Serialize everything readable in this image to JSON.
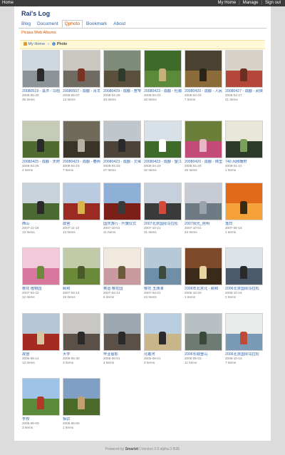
{
  "topbar": {
    "home": "Home",
    "my_home": "My Home",
    "manage": "Manage",
    "sign_out": "Sign out",
    "sep": "|"
  },
  "site_title": "Rai's Log",
  "nav": [
    {
      "label": "Blog",
      "active": false
    },
    {
      "label": "Document",
      "active": false
    },
    {
      "label": "Qphoto",
      "active": true
    },
    {
      "label": "Bookmark",
      "active": false
    },
    {
      "label": "About",
      "active": false
    }
  ],
  "section_title": "Picasa Web Albums",
  "breadcrumb": {
    "my_home": "My Home",
    "current": "Photo",
    "sep": "»"
  },
  "albums": [
    {
      "title": "20080519 - 溪洪 - 马柏镇",
      "date": "2008-05-20",
      "count": "35 Items"
    },
    {
      "title": "20080507 - 成都 - 青羊宫殿",
      "date": "2008-05-07",
      "count": "13 Items"
    },
    {
      "title": "20080429 - 成都 - 宽窄巷",
      "date": "2008-04-29",
      "count": "33 Items"
    },
    {
      "title": "20080423 - 成都 - 杜甫草堂",
      "date": "2008-04-23",
      "count": "32 Items"
    },
    {
      "title": "20080420 - 成都 - 人民公园",
      "date": "2008-04-20",
      "count": "7 Items"
    },
    {
      "title": "20080427 - 成都 - 武侯祠",
      "date": "2008-04-27",
      "count": "21 Items"
    },
    {
      "title": "20080425 - 成都 - 天府广场",
      "date": "2008-04-25",
      "count": "4 Items"
    },
    {
      "title": "20080423 - 成都 - 春熙路",
      "date": "2008-04-23",
      "count": "7 Items"
    },
    {
      "title": "20080423 - 成都 - 文殊院",
      "date": "2008-04-23",
      "count": "27 Items"
    },
    {
      "title": "20080423 - 成都 - 望江楼",
      "date": "2008-04-23",
      "count": "32 Items"
    },
    {
      "title": "20080420 - 成都 - 锦里",
      "date": "2008-04-20",
      "count": "26 Items"
    },
    {
      "title": "740 风和暖时",
      "date": "2008-01-10",
      "count": "1 Items"
    },
    {
      "title": "西山",
      "date": "2007-11-18",
      "count": "13 Items"
    },
    {
      "title": "故宫",
      "date": "2007-11-10",
      "count": "13 Items"
    },
    {
      "title": "国庆游行 - 升旗仪式",
      "date": "2007-10-01",
      "count": "11 Items"
    },
    {
      "title": "2007北京国际马拉松",
      "date": "2007-10-21",
      "count": "31 Items"
    },
    {
      "title": "2007阳光_昆明",
      "date": "2007-10-01",
      "count": "44 Items"
    },
    {
      "title": "落日",
      "date": "2007-05-18",
      "count": "1 Items"
    },
    {
      "title": "樱花 植物园",
      "date": "2007-04-22",
      "count": "12 Items"
    },
    {
      "title": "颐和",
      "date": "2007-04-14",
      "count": "19 Items"
    },
    {
      "title": "奥运 樱花园",
      "date": "2007-04-14",
      "count": "6 Items"
    },
    {
      "title": "樱花 玉渊潭",
      "date": "2007-04-01",
      "count": "22 Items"
    },
    {
      "title": "2006年北京北 - 颐和",
      "date": "2006-10-20",
      "count": "1 Items"
    },
    {
      "title": "2006北京国际马拉松",
      "date": "2006-10-15",
      "count": "2 Items"
    },
    {
      "title": "故宫",
      "date": "2006-08-14",
      "count": "13 Items"
    },
    {
      "title": "大学",
      "date": "2006-06-30",
      "count": "3 Items"
    },
    {
      "title": "毕业留影",
      "date": "2006-06-01",
      "count": "4 Items"
    },
    {
      "title": "北戴河",
      "date": "2006-06-01",
      "count": "3 Items"
    },
    {
      "title": "2006长城登山",
      "date": "2006-05-03",
      "count": "11 Items"
    },
    {
      "title": "2006北京国际马拉松",
      "date": "2006-10-15",
      "count": "7 Items"
    },
    {
      "title": "学校",
      "date": "2006-06-00",
      "count": "3 Items"
    },
    {
      "title": "相识",
      "date": "2006-06-00",
      "count": "1 Items"
    }
  ],
  "thumb_palettes": [
    [
      "#cfd8de",
      "#8b9397",
      "#2a2a2a"
    ],
    [
      "#c9c7c0",
      "#6f6b63",
      "#7a3322"
    ],
    [
      "#7f8b7a",
      "#5a4f3a",
      "#2e3a2b"
    ],
    [
      "#3f6b2a",
      "#5a8a3a",
      "#c7b07a"
    ],
    [
      "#4a4130",
      "#8c6b3a",
      "#2b2418"
    ],
    [
      "#d9d2c8",
      "#b4463a",
      "#6b2f24"
    ],
    [
      "#c6cbb8",
      "#4f6b2f",
      "#2a2a2a"
    ],
    [
      "#6f6a5a",
      "#3a3328",
      "#b8b0a0"
    ],
    [
      "#bfc6cc",
      "#4e4338",
      "#2a2a2a"
    ],
    [
      "#d8e0e8",
      "#3f6b2a",
      "#ffffff"
    ],
    [
      "#6b7f3a",
      "#c24b78",
      "#e6b7c4"
    ],
    [
      "#e9e7d8",
      "#2c3a2a",
      "#7ba05a"
    ],
    [
      "#c9d3dc",
      "#4b6a32",
      "#2a2a2a"
    ],
    [
      "#b8cbe0",
      "#9b2a22",
      "#d8b44a"
    ],
    [
      "#8fb0d6",
      "#7c1f19",
      "#3a3a3a"
    ],
    [
      "#c5d0dc",
      "#3a3a3a",
      "#d44a3a"
    ],
    [
      "#c7ccd4",
      "#6e7a84",
      "#9aa3aa"
    ],
    [
      "#e06a1a",
      "#f6a23a",
      "#3a2a10"
    ],
    [
      "#f2c9d8",
      "#d8779e",
      "#6d8a3a"
    ],
    [
      "#c2cba8",
      "#6a8a3a",
      "#4a5a2a"
    ],
    [
      "#f1e8de",
      "#c99aa0",
      "#6b5a3a"
    ],
    [
      "#b5c9d9",
      "#6f8fa8",
      "#3b4a3a"
    ],
    [
      "#7f4a2a",
      "#3a2a1a",
      "#e9d3a0"
    ],
    [
      "#dce4ea",
      "#4a5a6a",
      "#2a2a2a"
    ],
    [
      "#b7c6d6",
      "#a52a22",
      "#d8c4a0"
    ],
    [
      "#c9c7c3",
      "#5a5048",
      "#2a2a2a"
    ],
    [
      "#9ca7b0",
      "#5a5048",
      "#2a2a2a"
    ],
    [
      "#b9cfe1",
      "#c8b58a",
      "#2a2a2a"
    ],
    [
      "#b8c0c4",
      "#6f7a72",
      "#3a4a3a"
    ],
    [
      "#e8ecea",
      "#7a9ab6",
      "#c04a3a"
    ],
    [
      "#9ec3e6",
      "#5a8a3a",
      "#b03a2a"
    ],
    [
      "#7fa0c4",
      "#4a6a2a",
      "#c4a070"
    ]
  ],
  "footer": {
    "powered_by": "Powered by",
    "brand": "Smarbit",
    "sep": "|",
    "version": "Version 2.0 alpha 3 f535"
  }
}
